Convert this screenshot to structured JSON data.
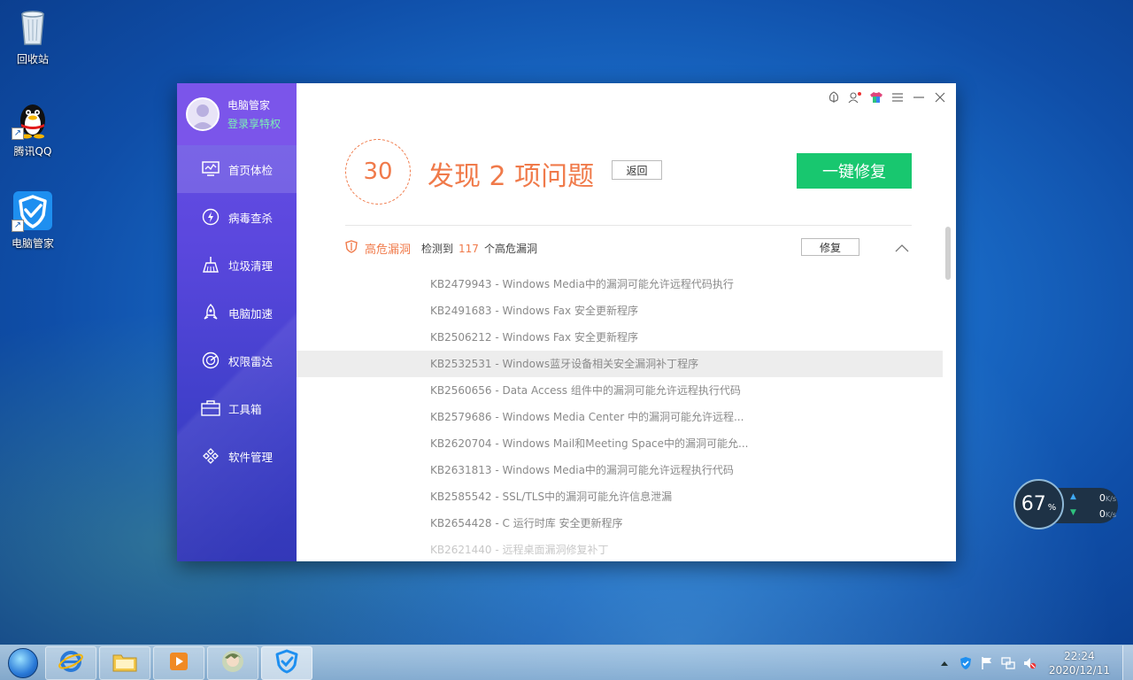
{
  "desktop": {
    "icons": [
      {
        "label": "回收站"
      },
      {
        "label": "腾讯QQ"
      },
      {
        "label": "电脑管家"
      }
    ]
  },
  "app": {
    "name": "电脑管家",
    "login_text": "登录享特权",
    "nav": [
      {
        "label": "首页体检",
        "icon": "monitor-icon"
      },
      {
        "label": "病毒查杀",
        "icon": "lightning-icon"
      },
      {
        "label": "垃圾清理",
        "icon": "broom-icon"
      },
      {
        "label": "电脑加速",
        "icon": "rocket-icon"
      },
      {
        "label": "权限雷达",
        "icon": "radar-icon"
      },
      {
        "label": "工具箱",
        "icon": "toolbox-icon"
      },
      {
        "label": "软件管理",
        "icon": "apps-icon"
      }
    ],
    "score": "30",
    "headline": "发现 2 项问题",
    "back_label": "返回",
    "fix_all_label": "一键修复",
    "section": {
      "title": "高危漏洞",
      "desc_prefix": "检测到",
      "count": "117",
      "desc_suffix": "个高危漏洞",
      "repair_label": "修复"
    },
    "vulnerabilities": [
      "KB2479943 - Windows Media中的漏洞可能允许远程代码执行",
      "KB2491683 - Windows Fax 安全更新程序",
      "KB2506212 - Windows Fax 安全更新程序",
      "KB2532531 - Windows蓝牙设备相关安全漏洞补丁程序",
      "KB2560656 - Data Access 组件中的漏洞可能允许远程执行代码",
      "KB2579686 - Windows Media Center 中的漏洞可能允许远程...",
      "KB2620704 - Windows Mail和Meeting Space中的漏洞可能允...",
      "KB2631813 - Windows Media中的漏洞可能允许远程执行代码",
      "KB2585542 - SSL/TLS中的漏洞可能允许信息泄漏",
      "KB2654428 - C 运行时库 安全更新程序",
      "KB2621440 - 远程桌面漏洞修复补丁"
    ]
  },
  "speed_widget": {
    "percent": "67",
    "percent_unit": "%",
    "up": "0",
    "down": "0",
    "unit": "K/s"
  },
  "taskbar": {
    "time": "22:24",
    "date": "2020/12/11"
  },
  "colors": {
    "accent_orange": "#f07a4a",
    "fix_green": "#18c76f",
    "sidebar_purple": "#5a47dd"
  }
}
